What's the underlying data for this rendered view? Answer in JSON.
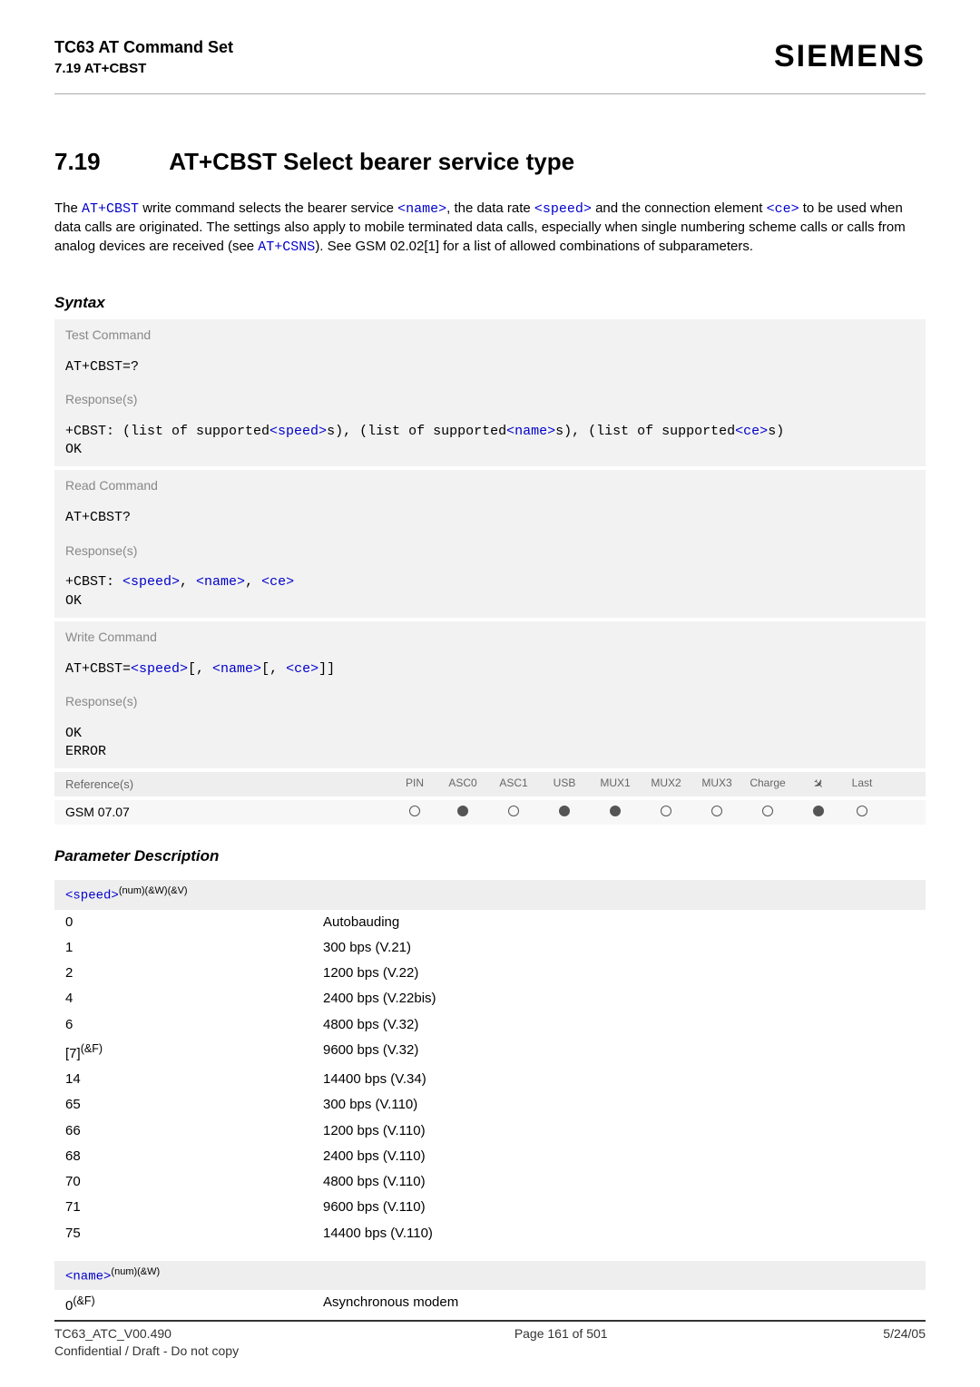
{
  "header": {
    "line1": "TC63 AT Command Set",
    "line2": "7.19 AT+CBST",
    "brand": "SIEMENS"
  },
  "section": {
    "number": "7.19",
    "title": "AT+CBST   Select bearer service type"
  },
  "intro": {
    "text_parts": {
      "p1a": "The ",
      "cmd1": "AT+CBST",
      "p1b": " write command selects the bearer service ",
      "tag_name": "<name>",
      "p1c": ", the data rate ",
      "tag_speed": "<speed>",
      "p1d": " and the connection element ",
      "tag_ce": "<ce>",
      "p1e": " to be used when data calls are originated. The settings also apply to mobile terminated data calls, especially when single numbering scheme calls or calls from analog devices are received (see ",
      "cmd2": "AT+CSNS",
      "p1f": "). See GSM 02.02[1] for a list of allowed combinations of subparameters."
    }
  },
  "syntax": {
    "heading": "Syntax",
    "test_label": "Test Command",
    "test_cmd": "AT+CBST=?",
    "response_label": "Response(s)",
    "test_resp_prefix": "+CBST: ",
    "test_resp_t1": "(list of supported",
    "test_resp_tag1": "<speed>",
    "test_resp_t2": "s), (list of supported",
    "test_resp_tag2": "<name>",
    "test_resp_t3": "s), (list of supported",
    "test_resp_tag3": "<ce>",
    "test_resp_t4": "s)",
    "ok": "OK",
    "read_label": "Read Command",
    "read_cmd": "AT+CBST?",
    "read_resp_prefix": "+CBST: ",
    "read_resp_tag1": "<speed>",
    "read_resp_sep": ", ",
    "read_resp_tag2": "<name>",
    "read_resp_tag3": "<ce>",
    "write_label": "Write Command",
    "write_cmd_a": "AT+CBST=",
    "write_cmd_b": "[, ",
    "write_cmd_c": "[, ",
    "write_cmd_d": "]]",
    "write_tag1": "<speed>",
    "write_tag2": "<name>",
    "write_tag3": "<ce>",
    "error": "ERROR"
  },
  "reference": {
    "label": "Reference(s)",
    "cols": [
      "PIN",
      "ASC0",
      "ASC1",
      "USB",
      "MUX1",
      "MUX2",
      "MUX3",
      "Charge",
      "",
      "Last"
    ],
    "row_label": "GSM 07.07",
    "row_states": [
      "empty",
      "full",
      "empty",
      "full",
      "full",
      "empty",
      "empty",
      "empty",
      "full",
      "empty"
    ]
  },
  "param_desc_heading": "Parameter Description",
  "param_speed": {
    "tag": "<speed>",
    "sup": "(num)(&W)(&V)",
    "rows": [
      {
        "k": "0",
        "v": "Autobauding"
      },
      {
        "k": "1",
        "v": "300 bps (V.21)"
      },
      {
        "k": "2",
        "v": "1200 bps (V.22)"
      },
      {
        "k": "4",
        "v": "2400 bps (V.22bis)"
      },
      {
        "k": "6",
        "v": "4800 bps (V.32)"
      },
      {
        "k": "[7]",
        "v": "9600 bps (V.32)",
        "ksup": "(&F)"
      },
      {
        "k": "14",
        "v": "14400 bps (V.34)"
      },
      {
        "k": "65",
        "v": "300 bps (V.110)"
      },
      {
        "k": "66",
        "v": "1200 bps (V.110)"
      },
      {
        "k": "68",
        "v": "2400 bps (V.110)"
      },
      {
        "k": "70",
        "v": "4800 bps (V.110)"
      },
      {
        "k": "71",
        "v": "9600 bps (V.110)"
      },
      {
        "k": "75",
        "v": "14400 bps (V.110)"
      }
    ]
  },
  "param_name": {
    "tag": "<name>",
    "sup": "(num)(&W)",
    "rows": [
      {
        "k": "0",
        "ksup": "(&F)",
        "v": "Asynchronous modem"
      }
    ]
  },
  "footer": {
    "left1": "TC63_ATC_V00.490",
    "left2": "Confidential / Draft - Do not copy",
    "center": "Page 161 of 501",
    "right": "5/24/05"
  }
}
